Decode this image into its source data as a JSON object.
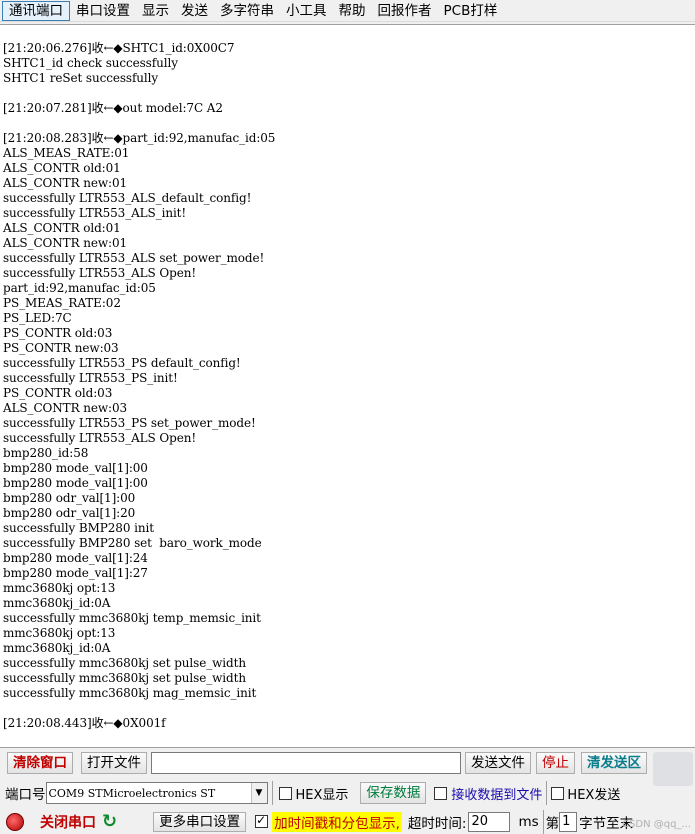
{
  "menu": [
    "通讯端口",
    "串口设置",
    "显示",
    "发送",
    "多字符串",
    "小工具",
    "帮助",
    "回报作者",
    "PCB打样"
  ],
  "log": [
    "[21:20:06.276]收←◆SHTC1_id:0X00C7",
    "SHTC1_id check successfully",
    "SHTC1 reSet successfully",
    "",
    "[21:20:07.281]收←◆out model:7C A2",
    "",
    "[21:20:08.283]收←◆part_id:92,manufac_id:05",
    "ALS_MEAS_RATE:01",
    "ALS_CONTR old:01",
    "ALS_CONTR new:01",
    "successfully LTR553_ALS_default_config!",
    "successfully LTR553_ALS_init!",
    "ALS_CONTR old:01",
    "ALS_CONTR new:01",
    "successfully LTR553_ALS set_power_mode!",
    "successfully LTR553_ALS Open!",
    "part_id:92,manufac_id:05",
    "PS_MEAS_RATE:02",
    "PS_LED:7C",
    "PS_CONTR old:03",
    "PS_CONTR new:03",
    "successfully LTR553_PS default_config!",
    "successfully LTR553_PS_init!",
    "PS_CONTR old:03",
    "ALS_CONTR new:03",
    "successfully LTR553_PS set_power_mode!",
    "successfully LTR553_ALS Open!",
    "bmp280_id:58",
    "bmp280 mode_val[1]:00",
    "bmp280 mode_val[1]:00",
    "bmp280 odr_val[1]:00",
    "bmp280 odr_val[1]:20",
    "successfully BMP280 init",
    "successfully BMP280 set  baro_work_mode",
    "bmp280 mode_val[1]:24",
    "bmp280 mode_val[1]:27",
    "mmc3680kj opt:13",
    "mmc3680kj_id:0A",
    "successfully mmc3680kj temp_memsic_init",
    "mmc3680kj opt:13",
    "mmc3680kj_id:0A",
    "successfully mmc3680kj set pulse_width",
    "successfully mmc3680kj set pulse_width",
    "successfully mmc3680kj mag_memsic_init",
    "",
    "[21:20:08.443]收←◆0X001f"
  ],
  "row1": {
    "clear_window": "清除窗口",
    "open_file": "打开文件",
    "send_file": "发送文件",
    "stop": "停止",
    "clear_send": "清发送区"
  },
  "row2": {
    "port_label": "端口号",
    "port_value": "COM9 STMicroelectronics ST",
    "hex_display": "HEX显示",
    "save_data": "保存数据",
    "recv_to_file": "接收数据到文件",
    "hex_send": "HEX发送"
  },
  "row3": {
    "close_port": "关闭串口",
    "more_ports": "更多串口设置",
    "timestamp": "加时间戳和分包显示,",
    "timeout_label": "超时时间:",
    "timeout_value": "20",
    "ms": "ms",
    "nth": "第",
    "nth_value": "1",
    "bytes": "字节至末"
  },
  "watermark": "CSDN @qq_..."
}
